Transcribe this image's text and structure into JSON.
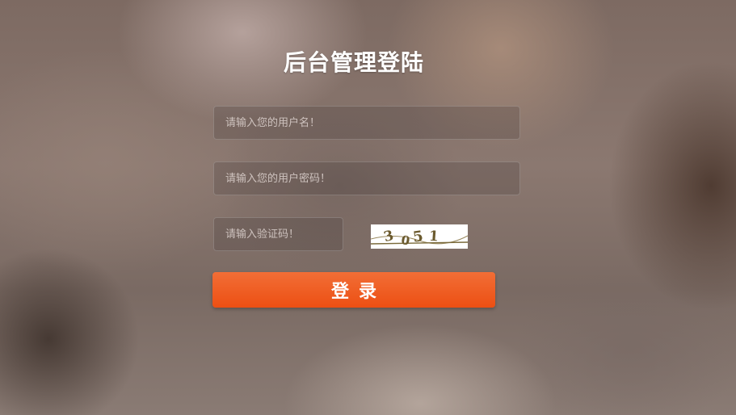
{
  "page": {
    "title": "后台管理登陆"
  },
  "form": {
    "username_placeholder": "请输入您的用户名！",
    "password_placeholder": "请输入您的用户密码！",
    "captcha_placeholder": "请输入验证码！",
    "captcha_code": "3051",
    "login_label": "登录"
  },
  "colors": {
    "button_top": "#f26e36",
    "button_bottom": "#ec4f13",
    "title_text": "#ffffff"
  }
}
